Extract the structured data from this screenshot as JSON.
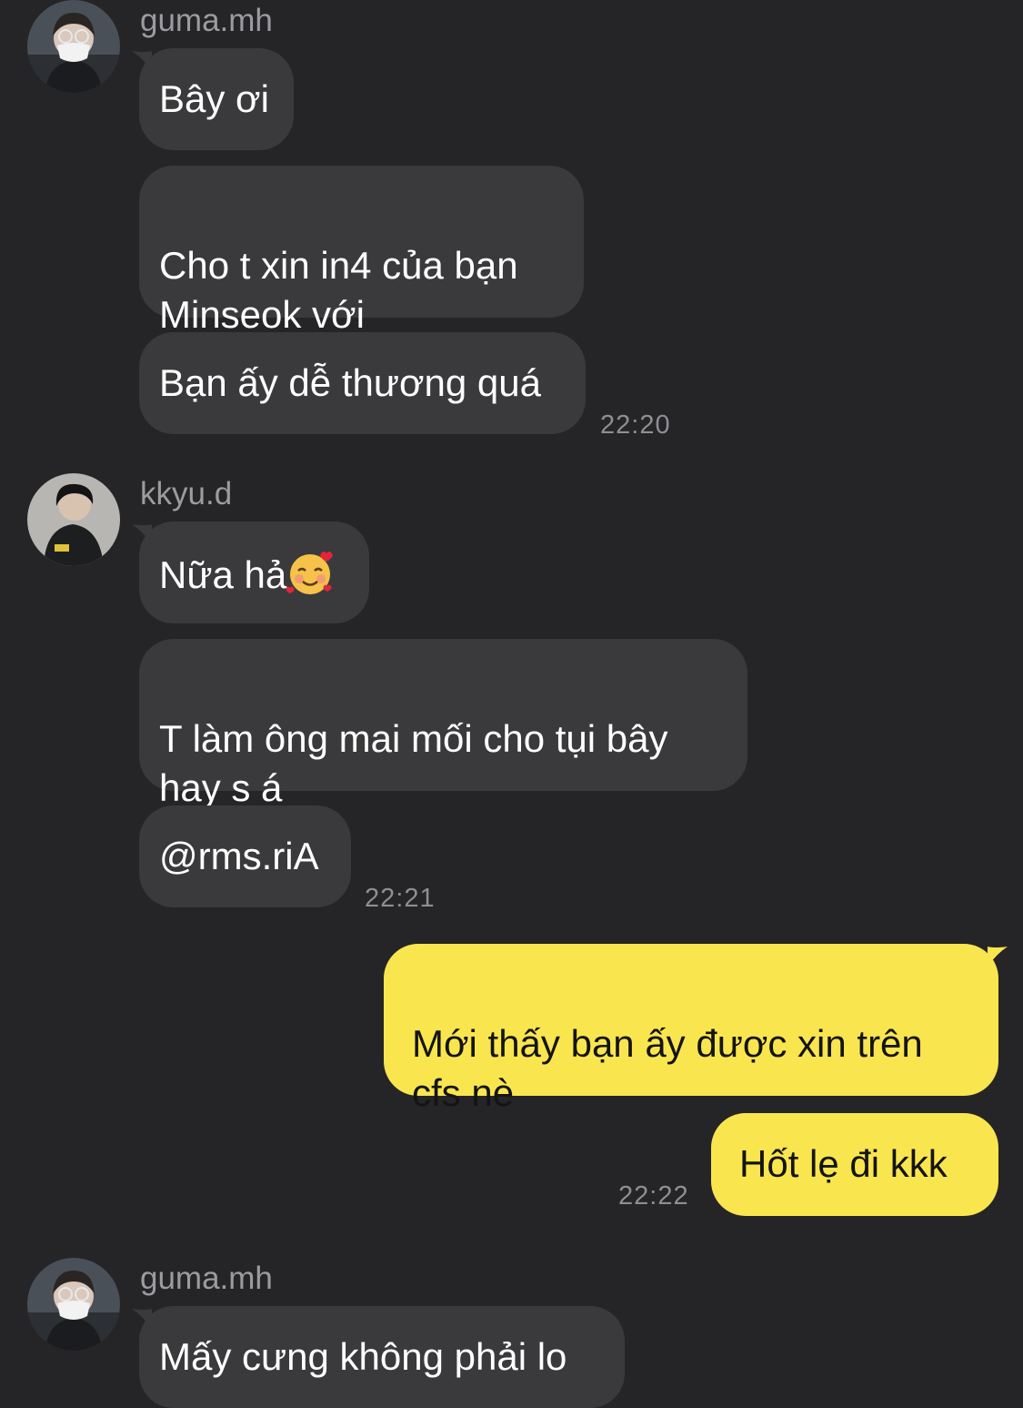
{
  "colors": {
    "background": "#252527",
    "incoming_bubble": "#3a3a3c",
    "outgoing_bubble": "#f9e64f",
    "sender_name": "#9b9ba0",
    "timestamp": "#8e8e93"
  },
  "groups": [
    {
      "sender": "guma.mh",
      "avatar_icon": "masked-person-avatar",
      "messages": [
        "Bây ơi",
        "Cho t xin in4 của bạn\nMinseok với",
        "Bạn ấy dễ thương quá"
      ],
      "time": "22:20"
    },
    {
      "sender": "kkyu.d",
      "avatar_icon": "person-avatar",
      "messages": [
        "Nữa hả",
        "T làm ông mai mối cho tụi bây\nhay s á",
        "@rms.riA"
      ],
      "emoji_icon": "smiling-face-with-hearts-icon",
      "time": "22:21"
    },
    {
      "sender": "me",
      "messages": [
        "Mới thấy bạn ấy được xin trên\ncfs nè",
        "Hốt lẹ đi kkk"
      ],
      "time": "22:22"
    },
    {
      "sender": "guma.mh",
      "avatar_icon": "masked-person-avatar",
      "messages": [
        "Mấy cưng không phải lo"
      ]
    }
  ]
}
